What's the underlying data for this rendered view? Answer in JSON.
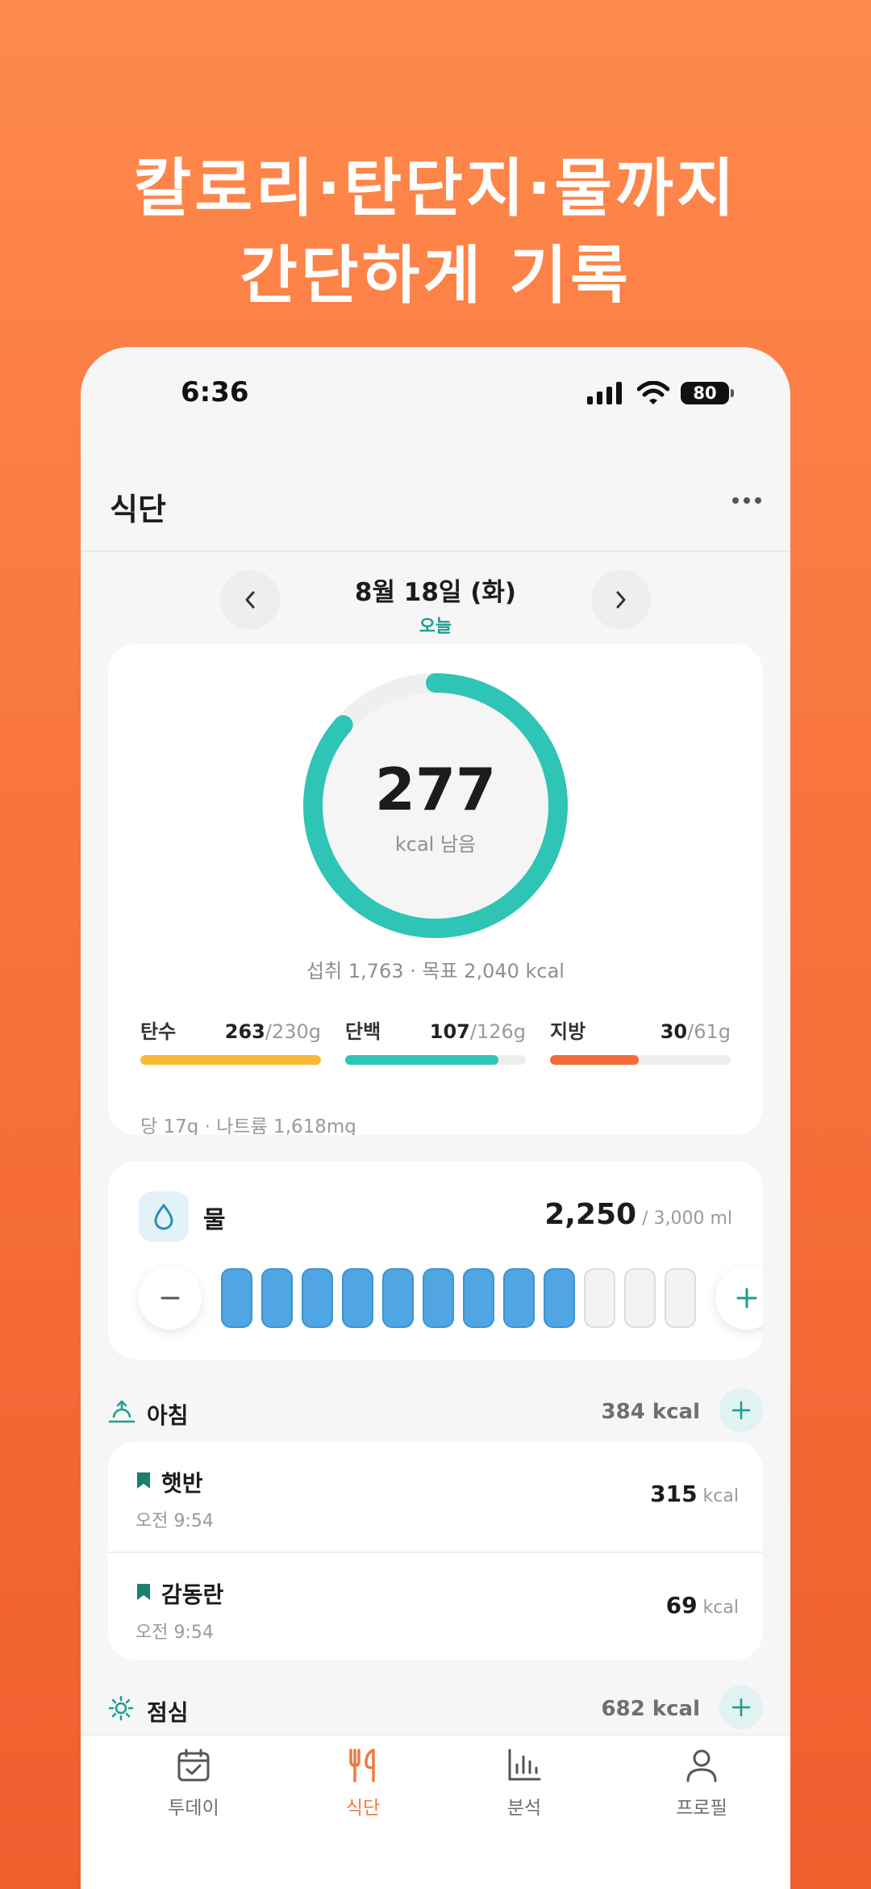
{
  "headline": {
    "line1": "칼로리·탄단지·물까지",
    "line2": "간단하게 기록"
  },
  "status": {
    "time": "6:36",
    "battery": "80"
  },
  "appbar": {
    "title": "식단"
  },
  "date": {
    "label": "8월 18일 (화)",
    "sub": "오늘"
  },
  "calories": {
    "remaining": "277",
    "remaining_label": "kcal 남음",
    "summary": "섭취 1,763 · 목표 2,040 kcal",
    "extra": "당 17g · 나트륨 1,618mg",
    "progress_fraction": 0.864
  },
  "macros": [
    {
      "name": "탄수",
      "value": "263",
      "target": "/230g",
      "fraction": 1.0,
      "color": "#F9B935"
    },
    {
      "name": "단백",
      "value": "107",
      "target": "/126g",
      "fraction": 0.85,
      "color": "#2EC4B6"
    },
    {
      "name": "지방",
      "value": "30",
      "target": "/61g",
      "fraction": 0.49,
      "color": "#F26B3A"
    }
  ],
  "water": {
    "title": "물",
    "amount": "2,250",
    "goal": " / 3,000 ml",
    "cups_filled": 9,
    "cups_total": 12,
    "color": "#4FA6E2"
  },
  "breakfast": {
    "title": "아침",
    "kcal": "384 kcal",
    "items": [
      {
        "name": "햇반",
        "time": "오전 9:54",
        "kcal": "315",
        "unit": " kcal"
      },
      {
        "name": "감동란",
        "time": "오전 9:54",
        "kcal": "69",
        "unit": " kcal"
      }
    ]
  },
  "lunch": {
    "title": "점심",
    "kcal": "682 kcal"
  },
  "tabs": [
    {
      "label": "투데이",
      "icon": "calendar-check-icon"
    },
    {
      "label": "식단",
      "icon": "fork-knife-icon",
      "active": true
    },
    {
      "label": "분석",
      "icon": "bar-chart-icon"
    },
    {
      "label": "프로필",
      "icon": "person-icon"
    }
  ],
  "colors": {
    "accent": "#2EC4B6",
    "brand": "#F07A3E",
    "background": "#FF8A4C"
  }
}
